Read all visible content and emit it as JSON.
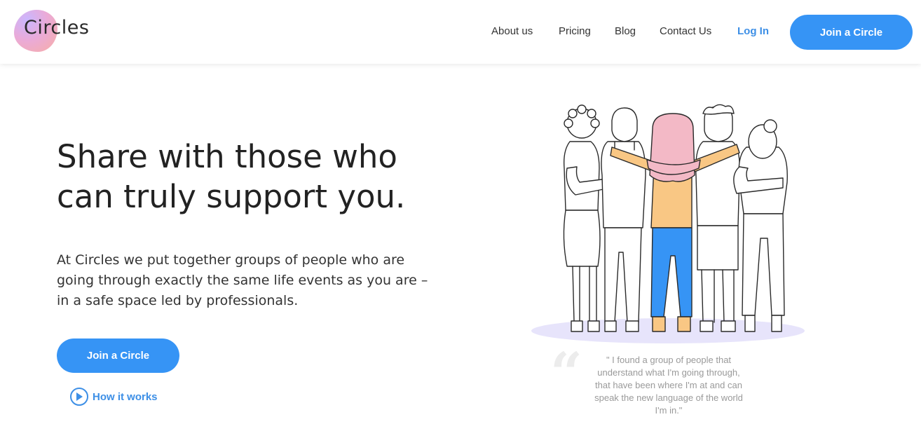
{
  "brand": {
    "name": "Circles",
    "accent_color": "#3694f5",
    "logo_gradient": [
      "#c7b3ff",
      "#e9a6d6",
      "#f7a9a0"
    ]
  },
  "nav": {
    "items": [
      "About us",
      "Pricing",
      "Blog",
      "Contact Us"
    ],
    "login_label": "Log In",
    "cta_label": "Join a Circle"
  },
  "hero": {
    "title_line1": "Share with those who",
    "title_line2": "can truly support you.",
    "desc_line1": "At Circles we put together groups of people who are",
    "desc_line2": "going through exactly the same life events as you are –",
    "desc_line3": "in a safe space led by professionals.",
    "cta_label": "Join a Circle",
    "how_label": "How it works"
  },
  "testimonial": {
    "line1": "\" I found a group of people that",
    "line2": "understand what I'm going through,",
    "line3": "that have been where I'm at and can",
    "line4": "speak the new language of the world",
    "line5": "I'm in.\""
  },
  "icons": {
    "logo": "circles-logo-blob",
    "play": "play-icon",
    "quote": "quote-icon",
    "illustration": "group-hug-illustration"
  },
  "colors": {
    "hair_pink": "#f3b9c6",
    "shirt_orange": "#f9c784",
    "jeans_blue": "#3694f5",
    "shadow_lavender": "#e7e4fb"
  }
}
